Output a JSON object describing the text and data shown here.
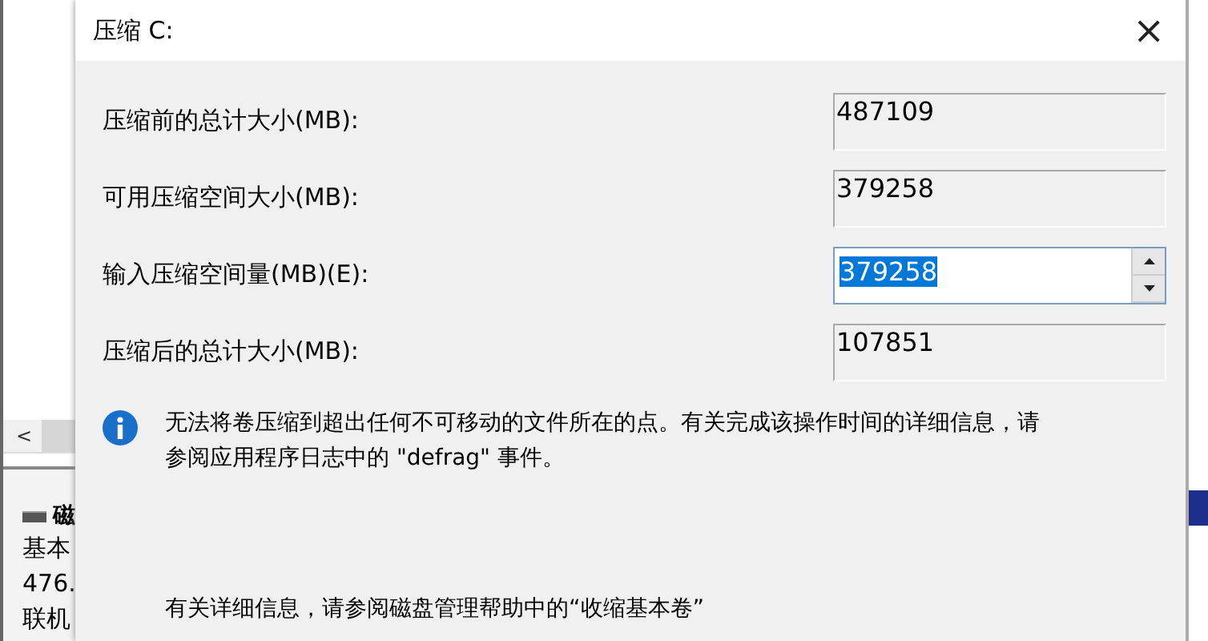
{
  "background_window": {
    "disk_label": "磁",
    "disk_lines": [
      "基本",
      "476.",
      "联机"
    ],
    "scroll_left": "<"
  },
  "dialog": {
    "title": "压缩 C:",
    "close": "×",
    "fields": [
      {
        "label": "压缩前的总计大小(MB):",
        "value": "487109",
        "kind": "readonly"
      },
      {
        "label": "可用压缩空间大小(MB):",
        "value": "379258",
        "kind": "readonly"
      },
      {
        "label": "输入压缩空间量(MB)(E):",
        "value": "379258",
        "kind": "spinner",
        "selected": true
      },
      {
        "label": "压缩后的总计大小(MB):",
        "value": "107851",
        "kind": "readonly"
      }
    ],
    "info": [
      "无法将卷压缩到超出任何不可移动的文件所在的点。有关完成该操作时间的详细信息，请",
      "参阅应用程序日志中的 \"defrag\" 事件。"
    ],
    "help": "有关详细信息，请参阅磁盘管理帮助中的“收缩基本卷”"
  }
}
